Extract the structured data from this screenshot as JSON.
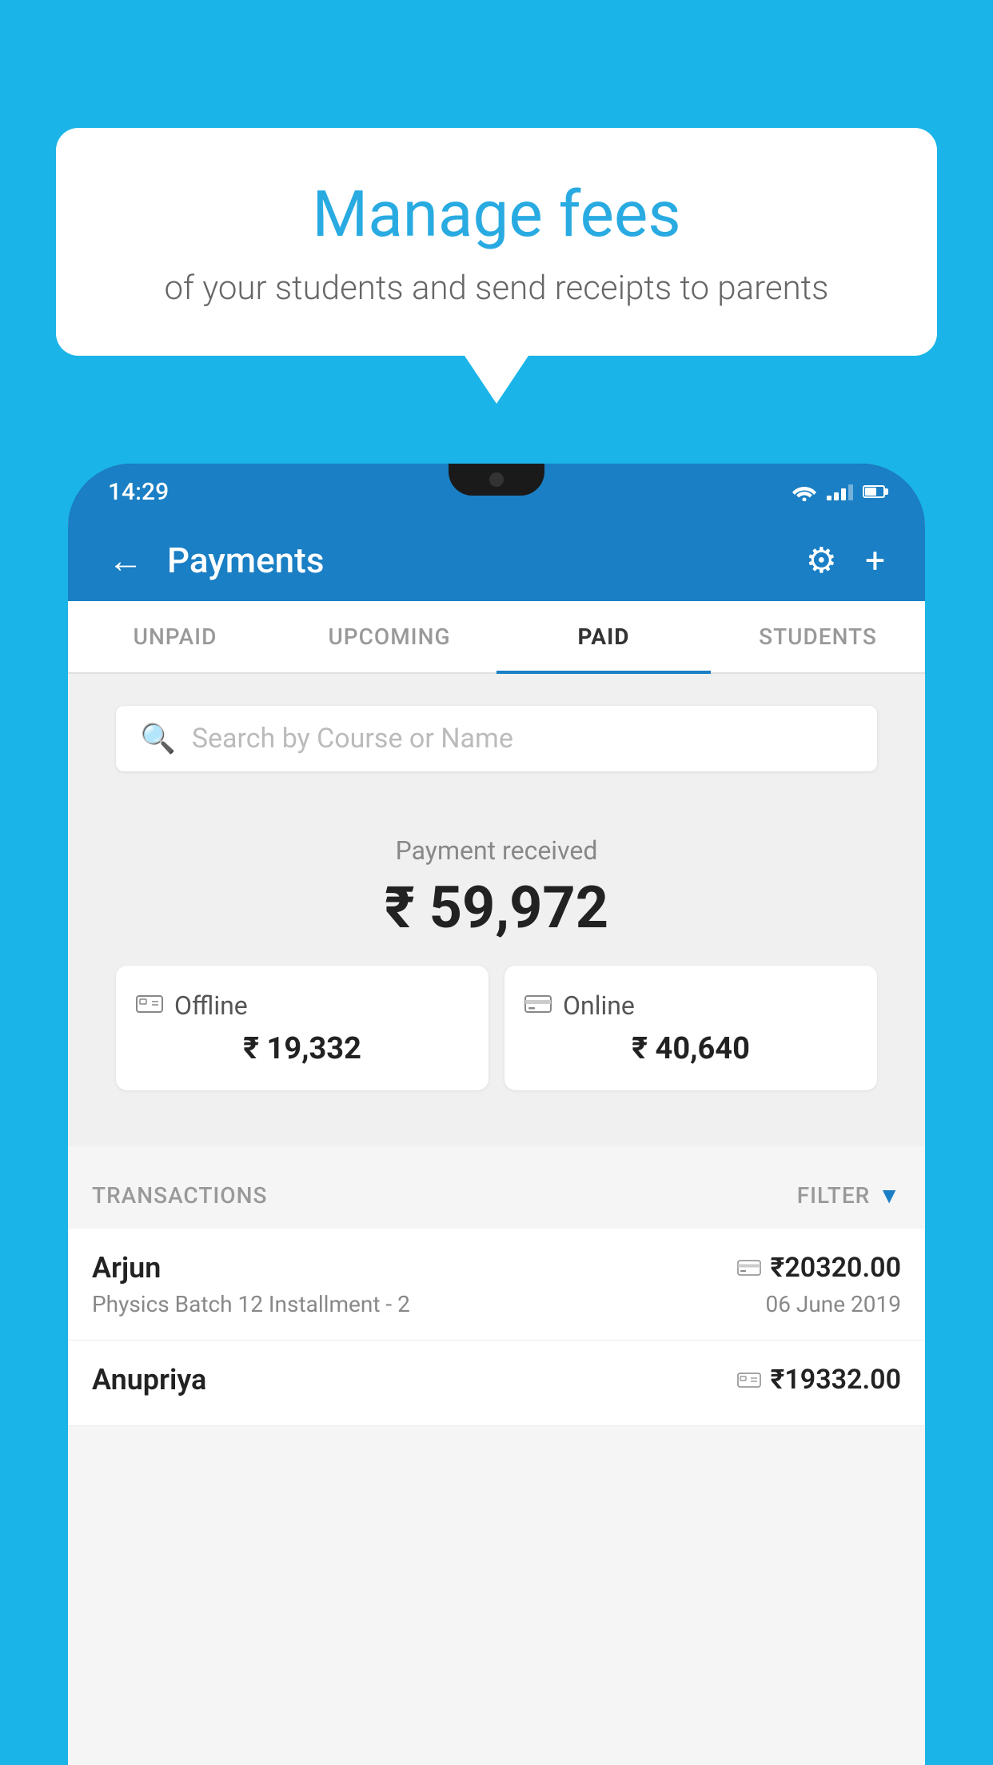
{
  "background_color": "#1ab4e8",
  "speech_bubble": {
    "title": "Manage fees",
    "subtitle": "of your students and send receipts to parents"
  },
  "status_bar": {
    "time": "14:29"
  },
  "header": {
    "title": "Payments",
    "back_label": "←",
    "settings_label": "⚙",
    "add_label": "+"
  },
  "tabs": [
    {
      "label": "UNPAID",
      "active": false
    },
    {
      "label": "UPCOMING",
      "active": false
    },
    {
      "label": "PAID",
      "active": true
    },
    {
      "label": "STUDENTS",
      "active": false
    }
  ],
  "search": {
    "placeholder": "Search by Course or Name"
  },
  "payment_received": {
    "label": "Payment received",
    "amount": "₹ 59,972"
  },
  "payment_cards": [
    {
      "type": "Offline",
      "amount": "₹ 19,332",
      "icon": "offline"
    },
    {
      "type": "Online",
      "amount": "₹ 40,640",
      "icon": "online"
    }
  ],
  "transactions_section": {
    "label": "TRANSACTIONS",
    "filter_label": "FILTER"
  },
  "transactions": [
    {
      "name": "Arjun",
      "course": "Physics Batch 12 Installment - 2",
      "amount": "₹20320.00",
      "date": "06 June 2019",
      "type_icon": "online"
    },
    {
      "name": "Anupriya",
      "course": "",
      "amount": "₹19332.00",
      "date": "",
      "type_icon": "offline"
    }
  ]
}
